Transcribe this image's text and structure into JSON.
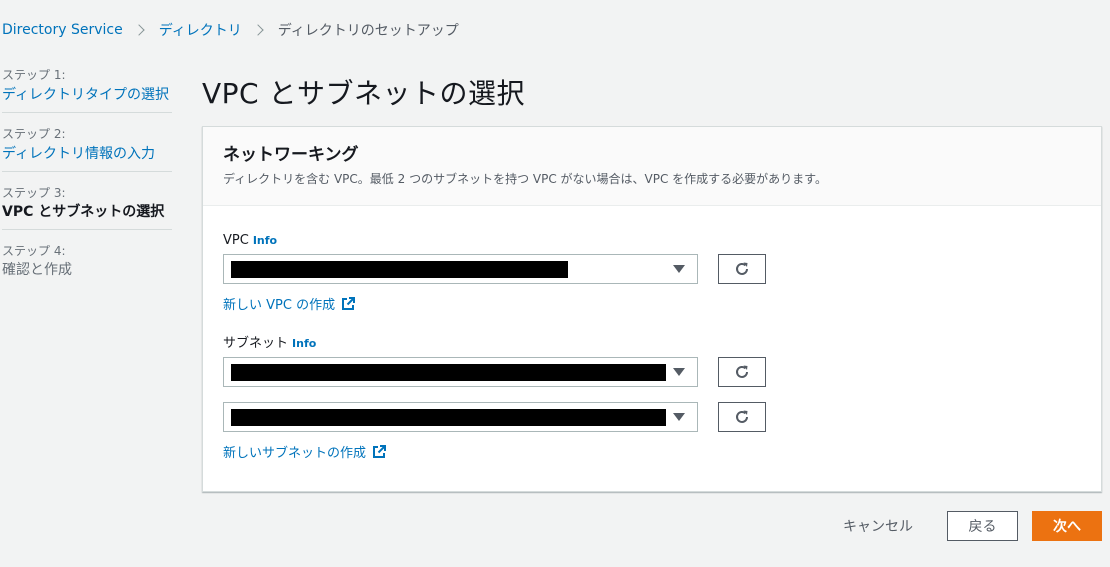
{
  "breadcrumb": {
    "items": [
      {
        "label": "Directory Service"
      },
      {
        "label": "ディレクトリ"
      },
      {
        "label": "ディレクトリのセットアップ"
      }
    ]
  },
  "steps": [
    {
      "num": "ステップ 1:",
      "label": "ディレクトリタイプの選択"
    },
    {
      "num": "ステップ 2:",
      "label": "ディレクトリ情報の入力"
    },
    {
      "num": "ステップ 3:",
      "label": "VPC とサブネットの選択"
    },
    {
      "num": "ステップ 4:",
      "label": "確認と作成"
    }
  ],
  "page_title": "VPC とサブネットの選択",
  "panel": {
    "title": "ネットワーキング",
    "description": "ディレクトリを含む VPC。最低 2 つのサブネットを持つ VPC がない場合は、VPC を作成する必要があります。",
    "vpc": {
      "label": "VPC",
      "info": "Info",
      "create_link": "新しい VPC の作成"
    },
    "subnet": {
      "label": "サブネット",
      "info": "Info",
      "create_link": "新しいサブネットの作成"
    }
  },
  "footer": {
    "cancel": "キャンセル",
    "back": "戻る",
    "next": "次へ"
  },
  "colors": {
    "link": "#0073bb",
    "primary": "#ec7211",
    "background": "#f2f3f3"
  },
  "icons": {
    "refresh": "refresh-icon",
    "external": "external-link-icon",
    "caret": "caret-down-icon"
  }
}
